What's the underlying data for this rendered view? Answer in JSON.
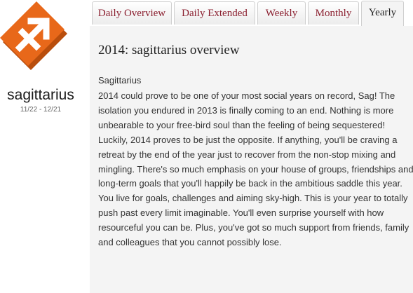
{
  "sign": {
    "name": "sagittarius",
    "dates": "11/22 - 12/21",
    "logo_icon": "sagittarius-arrow-icon",
    "colors": {
      "logo_orange": "#e8681a",
      "logo_dark": "#b94e0d"
    }
  },
  "tabs": [
    {
      "label": "Daily Overview",
      "active": false
    },
    {
      "label": "Daily Extended",
      "active": false
    },
    {
      "label": "Weekly",
      "active": false
    },
    {
      "label": "Monthly",
      "active": false
    },
    {
      "label": "Yearly",
      "active": true
    }
  ],
  "content": {
    "title": "2014: sagittarius overview",
    "label": "Sagittarius",
    "body": "2014 could prove to be one of your most social years on record, Sag! The isolation you endured in 2013 is finally coming to an end. Nothing is more unbearable to your free-bird soul than the feeling of being sequestered! Luckily, 2014 proves to be just the opposite. If anything, you'll be craving a retreat by the end of the year just to recover from the non-stop mixing and mingling. There's so much emphasis on your house of groups, friendships and long-term goals that you'll happily be back in the ambitious saddle this year. You live for goals, challenges and aiming sky-high. This is your year to totally push past every limit imaginable. You'll even surprise yourself with how resourceful you can be. Plus, you've got so much support from friends, family and colleagues that you cannot possibly lose."
  },
  "colors": {
    "tab_text": "#8a1e2e",
    "content_bg": "#f4f4f4"
  }
}
